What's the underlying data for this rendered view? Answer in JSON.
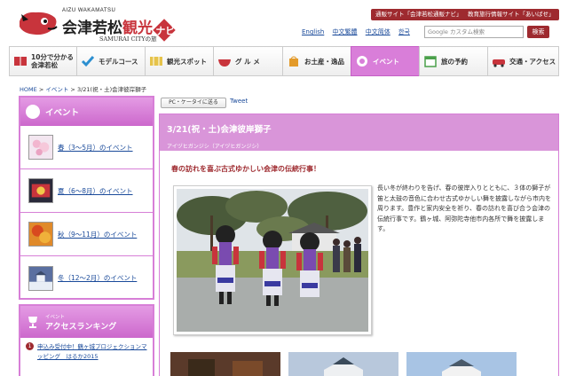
{
  "header": {
    "logo_small": "AIZU WAKAMATSU",
    "logo_main": "会津若松",
    "logo_kanko": "観光",
    "logo_navi": "ナビ",
    "logo_sub": "SAMURAI CITYの旅",
    "top_buttons": [
      "通販サイト「会津若松通販ナビ」",
      "教育旅行情報サイト「あいばせ」"
    ],
    "languages": [
      "English",
      "中文繁體",
      "中文简体",
      "한국"
    ],
    "search_placeholder": "Google カスタム検索",
    "search_button": "検索"
  },
  "nav": {
    "items": [
      {
        "label_line1": "10分で分かる",
        "label_line2": "会津若松",
        "icon": "book-icon"
      },
      {
        "label": "モデルコース",
        "icon": "check-icon"
      },
      {
        "label": "観光スポット",
        "icon": "map-icon"
      },
      {
        "label": "グ ル メ",
        "icon": "bowl-icon"
      },
      {
        "label": "お土産・逸品",
        "icon": "bag-icon"
      },
      {
        "label": "イベント",
        "icon": "event-icon"
      },
      {
        "label": "旅の予約",
        "icon": "calendar-icon"
      },
      {
        "label": "交通・アクセス",
        "icon": "car-icon"
      }
    ],
    "active_index": 5,
    "accent_color": "#d97ed9"
  },
  "breadcrumb": {
    "home": "HOME",
    "sep": ">",
    "event": "イベント",
    "current": "3/21(祝・土)会津彼岸獅子"
  },
  "sidebar": {
    "event_title": "イベント",
    "seasons": [
      {
        "label": "春（3〜5月）のイベント"
      },
      {
        "label": "夏（6〜8月）のイベント"
      },
      {
        "label": "秋（9〜11月）のイベント"
      },
      {
        "label": "冬（12〜2月）のイベント"
      }
    ],
    "ranking_small": "イベント",
    "ranking_title": "アクセスランキング",
    "ranking_items": [
      {
        "num": "1",
        "text": "申込み受付中！鶴ヶ城プロジェクションマッピング　はるか2015"
      }
    ]
  },
  "share": {
    "pc_label": "PC・ケータイに送る",
    "tweet": "Tweet"
  },
  "article": {
    "title": "3/21(祝・土)会津彼岸獅子",
    "reading": "アイヅヒガンジシ（アイヅヒガンジシ）",
    "catch": "春の訪れを喜ぶ古式ゆかしい会津の伝統行事！",
    "description": "長い冬が終わりを告げ、春の彼岸入りとともに、３体の獅子が笛と太鼓の音色に合わせ古式ゆかしい舞を披露しながら市内を周ります。豊作と家内安全を祈り、春の訪れを喜び合う会津の伝統行事です。鶴ヶ城、阿弥陀寺他市内各所で舞を披露します。"
  },
  "colors": {
    "brand_red": "#9e2a2f",
    "accent_purple": "#d77fd7",
    "link_blue": "#1a4a9a"
  }
}
